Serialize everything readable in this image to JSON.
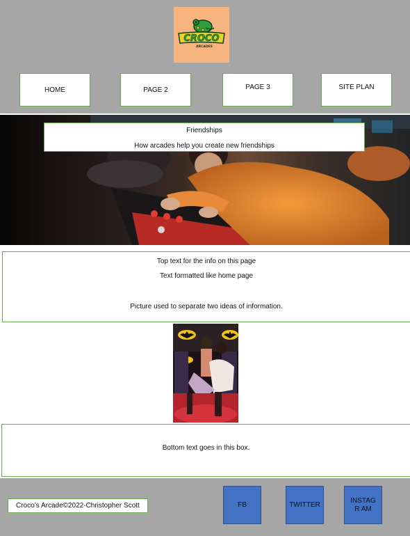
{
  "header": {
    "logo": {
      "title": "CROCO",
      "subtitle": "ARCADES",
      "icon": "crocodile-icon"
    }
  },
  "nav": {
    "items": [
      {
        "label": "HOME"
      },
      {
        "label": "PAGE 2"
      },
      {
        "label": "PAGE 3"
      },
      {
        "label": "SITE PLAN"
      }
    ]
  },
  "hero": {
    "title": "Friendships",
    "subtitle": "How arcades help you create new friendships"
  },
  "info": {
    "line1": "Top text for the info on this page",
    "line2": "Text formatted like home page",
    "line3": "Picture used to separate two ideas of information."
  },
  "bottom": {
    "text": "Bottom text goes in this box."
  },
  "footer": {
    "copyright": "Croco’s Arcade©2022-Christopher Scott",
    "social": [
      {
        "label": "FB"
      },
      {
        "label": "TWITTER"
      },
      {
        "label": "INSTAGR AM"
      }
    ]
  },
  "colors": {
    "header_bg": "#a6a6a6",
    "border_green": "#6aa84f",
    "social_blue": "#4472c4",
    "logo_bg": "#f8b47e"
  }
}
